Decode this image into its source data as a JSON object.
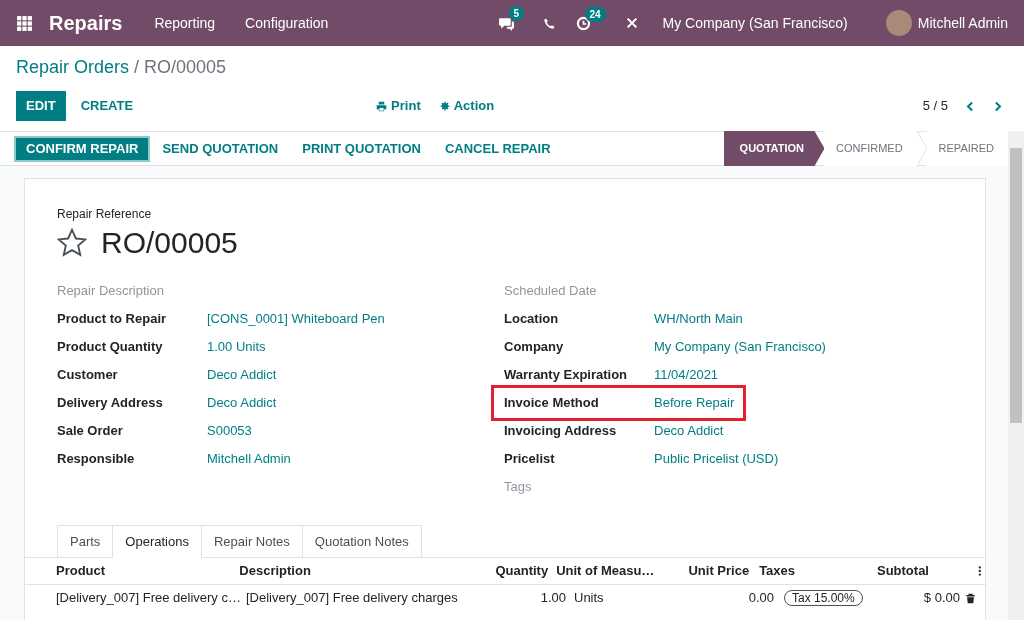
{
  "navbar": {
    "app": "Repairs",
    "menu": [
      "Reporting",
      "Configuration"
    ],
    "messages_count": "5",
    "activities_count": "24",
    "company": "My Company (San Francisco)",
    "user": "Mitchell Admin"
  },
  "breadcrumb": {
    "parent": "Repair Orders",
    "separator": "/",
    "current": "RO/00005"
  },
  "control_panel": {
    "edit": "EDIT",
    "create": "CREATE",
    "print": "Print",
    "action": "Action",
    "pager": "5 / 5"
  },
  "header_buttons": [
    {
      "label": "CONFIRM REPAIR",
      "primary": true
    },
    {
      "label": "SEND QUOTATION",
      "primary": false
    },
    {
      "label": "PRINT QUOTATION",
      "primary": false
    },
    {
      "label": "CANCEL REPAIR",
      "primary": false
    }
  ],
  "stages": [
    {
      "label": "QUOTATION",
      "selected": true
    },
    {
      "label": "CONFIRMED",
      "selected": false
    },
    {
      "label": "REPAIRED",
      "selected": false
    }
  ],
  "form": {
    "reference_label": "Repair Reference",
    "reference": "RO/00005",
    "starred": false,
    "left_fields": [
      {
        "kind": "empty",
        "label": "Repair Description"
      },
      {
        "kind": "field",
        "label": "Product to Repair",
        "value": "[CONS_0001] Whiteboard Pen",
        "highlighted": false
      },
      {
        "kind": "field",
        "label": "Product Quantity",
        "value": "1.00 Units",
        "highlighted": false
      },
      {
        "kind": "field",
        "label": "Customer",
        "value": "Deco Addict",
        "highlighted": false
      },
      {
        "kind": "field",
        "label": "Delivery Address",
        "value": "Deco Addict",
        "highlighted": false
      },
      {
        "kind": "field",
        "label": "Sale Order",
        "value": "S00053",
        "highlighted": false
      },
      {
        "kind": "field",
        "label": "Responsible",
        "value": "Mitchell Admin",
        "highlighted": false
      }
    ],
    "right_fields": [
      {
        "kind": "empty",
        "label": "Scheduled Date"
      },
      {
        "kind": "field",
        "label": "Location",
        "value": "WH/North Main",
        "highlighted": false
      },
      {
        "kind": "field",
        "label": "Company",
        "value": "My Company (San Francisco)",
        "highlighted": false
      },
      {
        "kind": "field",
        "label": "Warranty Expiration",
        "value": "11/04/2021",
        "highlighted": false
      },
      {
        "kind": "field",
        "label": "Invoice Method",
        "value": "Before Repair",
        "highlighted": true
      },
      {
        "kind": "field",
        "label": "Invoicing Address",
        "value": "Deco Addict",
        "highlighted": false
      },
      {
        "kind": "field",
        "label": "Pricelist",
        "value": "Public Pricelist (USD)",
        "highlighted": false
      },
      {
        "kind": "empty",
        "label": "Tags"
      }
    ]
  },
  "tabs": [
    {
      "label": "Parts",
      "selected": false
    },
    {
      "label": "Operations",
      "selected": true
    },
    {
      "label": "Repair Notes",
      "selected": false
    },
    {
      "label": "Quotation Notes",
      "selected": false
    }
  ],
  "table": {
    "columns": [
      "Product",
      "Description",
      "Quantity",
      "Unit of Measu…",
      "Unit Price",
      "Taxes",
      "Subtotal"
    ],
    "rows": [
      {
        "product": "[Delivery_007] Free delivery c…",
        "description": "[Delivery_007] Free delivery charges",
        "quantity": "1.00",
        "uom": "Units",
        "unit_price": "0.00",
        "tax": "Tax 15.00%",
        "subtotal": "$ 0.00"
      }
    ]
  }
}
